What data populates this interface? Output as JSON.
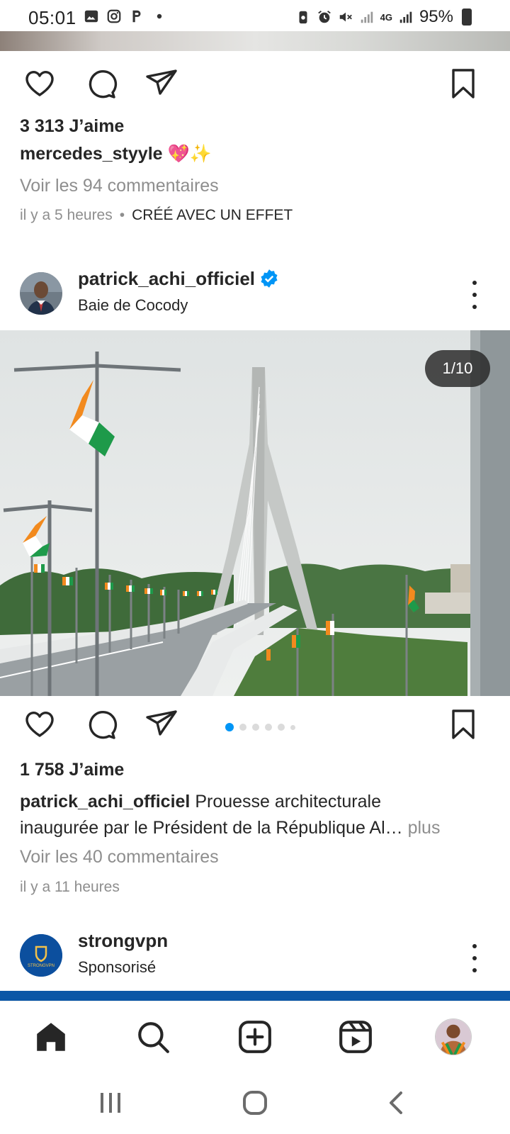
{
  "status_bar": {
    "time": "05:01",
    "battery": "95%",
    "icons": [
      "gallery-icon",
      "instagram-icon",
      "p-icon",
      "notification-dot-icon",
      "battery-saver-icon",
      "alarm-icon",
      "mute-icon",
      "signal-icon",
      "4g-icon",
      "signal-icon",
      "battery-icon"
    ],
    "network": "4G"
  },
  "previous_post": {
    "likes": "3 313 J’aime",
    "username": "mercedes_styyle",
    "caption_emoji": "💖✨",
    "comments_link": "Voir les 94 commentaires",
    "time_ago": "il y a 5 heures",
    "separator": "•",
    "effect_label": "CRÉÉ AVEC UN EFFET"
  },
  "post": {
    "username": "patrick_achi_officiel",
    "verified": true,
    "location": "Baie de Cocody",
    "carousel_counter": "1/10",
    "carousel_position": 1,
    "carousel_total": 10,
    "likes": "1 758 J’aime",
    "caption_user": "patrick_achi_officiel",
    "caption_text_1": " Prouesse architecturale",
    "caption_text_2": "inaugurée par le Président de la République Al",
    "caption_ellipsis": "…",
    "caption_more": " plus",
    "comments_link": "Voir les 40 commentaires",
    "time_ago": "il y a 11 heures"
  },
  "sponsored_post": {
    "username": "strongvpn",
    "label": "Sponsorisé",
    "logo_text": "STRONGVPN"
  },
  "bottom_nav": {
    "items": [
      "home-icon",
      "search-icon",
      "create-icon",
      "reels-icon",
      "profile-avatar"
    ]
  },
  "colors": {
    "text": "#262626",
    "muted": "#8e8e8e",
    "accent": "#0095f6",
    "verified": "#0095f6",
    "sponsor_blue": "#0b56a6"
  }
}
